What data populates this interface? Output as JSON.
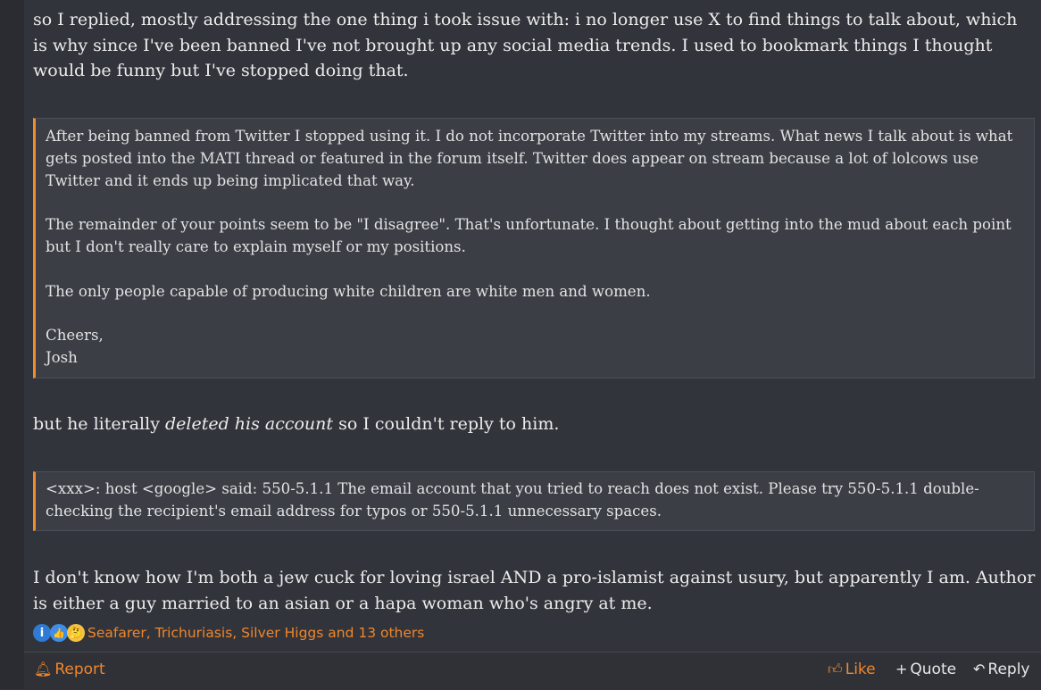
{
  "post": {
    "para1": "so I replied, mostly addressing the one thing i took issue with: i no longer use X to find things to talk about, which is why since I've been banned I've not brought up any social media trends. I used to bookmark things I thought would be funny but I've stopped doing that.",
    "quote1": {
      "p1": "After being banned from Twitter I stopped using it. I do not incorporate Twitter into my streams. What news I talk about is what gets posted into the MATI thread or featured in the forum itself. Twitter does appear on stream because a lot of lolcows use Twitter and it ends up being implicated that way.",
      "p2": "The remainder of your points seem to be \"I disagree\". That's unfortunate. I thought about getting into the mud about each point but I don't really care to explain myself or my positions.",
      "p3": "The only people capable of producing white children are white men and women.",
      "sign_line1": "Cheers,",
      "sign_line2": "Josh"
    },
    "para2_before": "but he literally ",
    "para2_em": "deleted his account",
    "para2_after": " so I couldn't reply to him.",
    "quote2": "<xxx>: host <google> said: 550-5.1.1 The email account that you tried to reach does not exist. Please try 550-5.1.1 double-checking the recipient's email address for typos or 550-5.1.1 unnecessary spaces.",
    "para3": "I don't know how I'm both a jew cuck for loving israel AND a pro-islamist against usury, but apparently I am. Author is either a guy married to an asian or a hapa woman who's angry at me."
  },
  "reactions": {
    "icons": [
      "informative-icon",
      "like-icon",
      "thinking-icon"
    ],
    "names": "Seafarer, Trichuriasis, Silver Higgs and 13 others"
  },
  "footer": {
    "report": "Report",
    "like": "Like",
    "quote": "Quote",
    "reply": "Reply"
  },
  "colors": {
    "accent": "#f0862a",
    "background": "#32343b",
    "quote_bg": "#3b3e45"
  }
}
